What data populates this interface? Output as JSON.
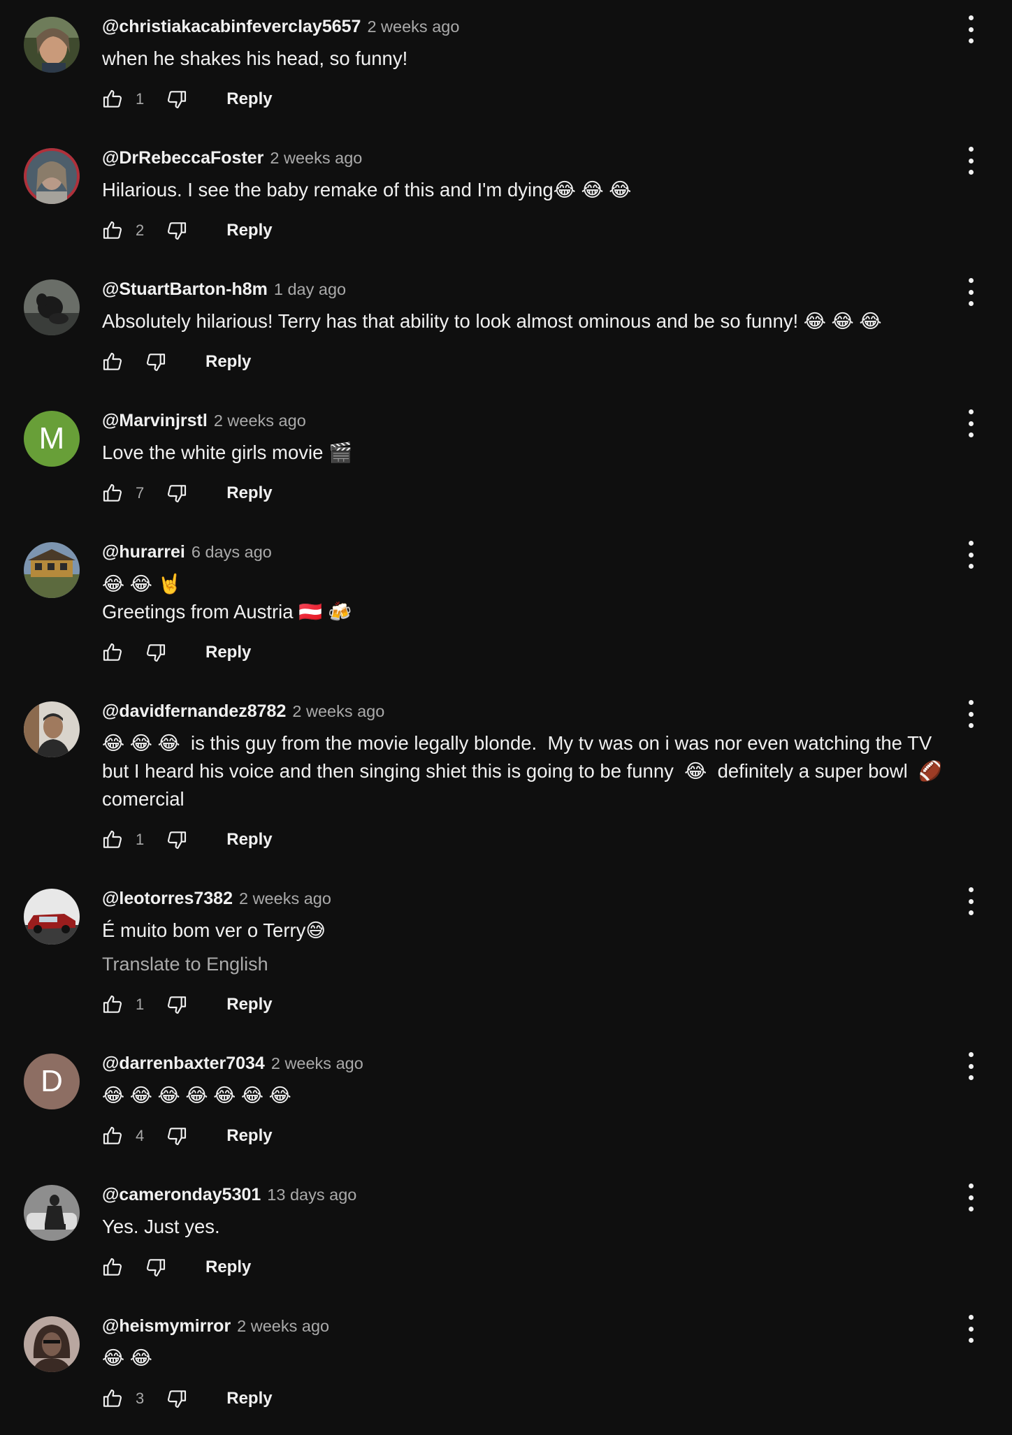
{
  "comments": [
    {
      "author": "@christiakacabinfeverclay5657",
      "time": "2 weeks ago",
      "text": "when he shakes his head, so funny!",
      "likes": "1",
      "reply_label": "Reply",
      "avatar": {
        "type": "photo",
        "colors": [
          "#6e5b48",
          "#c99a7a",
          "#3f4a2e"
        ]
      }
    },
    {
      "author": "@DrRebeccaFoster",
      "time": "2 weeks ago",
      "text": "Hilarious. I see the baby remake of this and I'm dying😂 😂 😂",
      "likes": "2",
      "reply_label": "Reply",
      "avatar": {
        "type": "photo",
        "colors": [
          "#4d5e6b",
          "#a5a29b",
          "#b0303a"
        ]
      }
    },
    {
      "author": "@StuartBarton-h8m",
      "time": "1 day ago",
      "text": "Absolutely hilarious! Terry has that ability to look almost ominous and be so funny! 😂 😂 😂",
      "likes": "",
      "reply_label": "Reply",
      "avatar": {
        "type": "photo",
        "colors": [
          "#3a3d3a",
          "#1a1a1a",
          "#6a6e68"
        ]
      }
    },
    {
      "author": "@Marvinjrstl",
      "time": "2 weeks ago",
      "text": "Love the white girls movie 🎬",
      "likes": "7",
      "reply_label": "Reply",
      "avatar": {
        "type": "initial",
        "letter": "M",
        "bg": "#689f38"
      }
    },
    {
      "author": "@hurarrei",
      "time": "6 days ago",
      "text": "😂 😂 🤘\nGreetings from Austria 🇦🇹 🍻",
      "likes": "",
      "reply_label": "Reply",
      "avatar": {
        "type": "photo",
        "colors": [
          "#7d95b0",
          "#b58a3c",
          "#5c6a3e"
        ]
      }
    },
    {
      "author": "@davidfernandez8782",
      "time": "2 weeks ago",
      "text": "😂 😂 😂  is this guy from the movie legally blonde.  My tv was on i was nor even watching the TV  but I heard his voice and then singing shiet this is going to be funny  😂  definitely a super bowl  🏈 comercial",
      "likes": "1",
      "reply_label": "Reply",
      "avatar": {
        "type": "photo",
        "colors": [
          "#d9d4cc",
          "#2a2a2a",
          "#8b6a4e"
        ]
      }
    },
    {
      "author": "@leotorres7382",
      "time": "2 weeks ago",
      "text": "É muito bom ver o Terry😅",
      "translate": "Translate to English",
      "likes": "1",
      "reply_label": "Reply",
      "avatar": {
        "type": "photo",
        "colors": [
          "#e8e8e8",
          "#9a1d1d",
          "#3b3b3b"
        ]
      }
    },
    {
      "author": "@darrenbaxter7034",
      "time": "2 weeks ago",
      "text": "😂 😂 😂 😂 😂 😂 😂",
      "likes": "4",
      "reply_label": "Reply",
      "avatar": {
        "type": "initial",
        "letter": "D",
        "bg": "#8d6e63"
      }
    },
    {
      "author": "@cameronday5301",
      "time": "13 days ago",
      "text": "Yes. Just yes.",
      "likes": "",
      "reply_label": "Reply",
      "avatar": {
        "type": "photo",
        "colors": [
          "#8e8e8e",
          "#222222",
          "#dcdcdc"
        ]
      }
    },
    {
      "author": "@heismymirror",
      "time": "2 weeks ago",
      "text": "😂 😂",
      "likes": "3",
      "reply_label": "Reply",
      "avatar": {
        "type": "photo",
        "colors": [
          "#b9a7a0",
          "#3a2a24",
          "#7a5c4e"
        ]
      }
    }
  ],
  "icons": {
    "like": "thumbs-up-icon",
    "dislike": "thumbs-down-icon",
    "menu": "more-vert-icon"
  },
  "theme": {
    "background": "#0f0f0f",
    "text_primary": "#f1f1f1",
    "text_secondary": "#aaaaaa"
  }
}
